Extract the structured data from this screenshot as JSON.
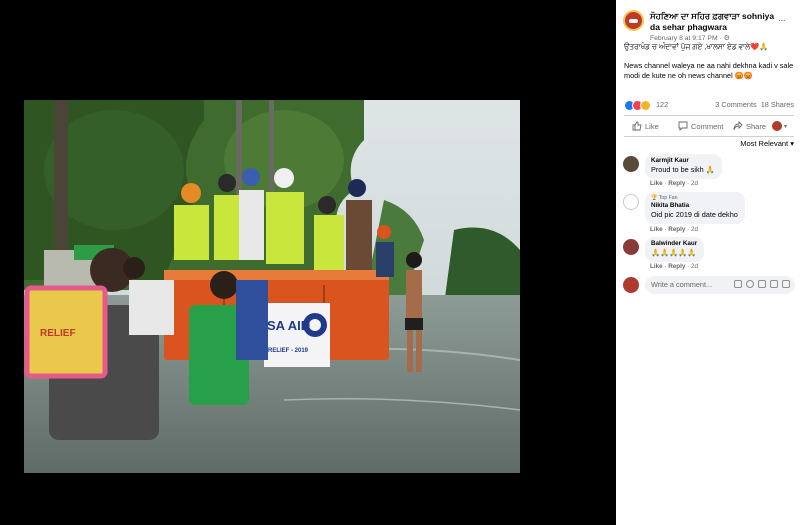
{
  "post": {
    "page_name": "ਸੋਹਣਿਆ ਦਾ ਸਹਿਰ ਫ਼ਗਵਾੜਾ sohniya da sehar phagwara",
    "meta": "February 8 at 9:17 PM · ⚙",
    "more": "···",
    "text_line1": "ਉਤਰਾਖੰਡ ਚ ਅੰਦਾਵਾਂ ਪੁੱਜ ਗਏ ,ਖਾਲਸਾ ਏਡ ਵਾਲੇ❤️🙏",
    "text_line2": "News channel waleya ne aa nahi dekhna kadi v sale modi de kute ne oh news channel 😡😡"
  },
  "photo": {
    "banner_text": "SA AID",
    "banner_sub": "RELIEF - 2019",
    "bag_text": "RELIEF"
  },
  "reactions": {
    "count": "122",
    "comments": "3 Comments",
    "shares": "18 Shares",
    "colors": [
      "#1877f2",
      "#f33e58",
      "#f7b125"
    ]
  },
  "actions": {
    "like": "Like",
    "comment": "Comment",
    "share": "Share"
  },
  "sort": {
    "label": "Most Relevant ▾"
  },
  "comments": [
    {
      "name": "Karmjit Kaur",
      "badge": "",
      "text": "Proud to be sikh 🙏",
      "like": "Like",
      "reply": "Reply",
      "time": "2d"
    },
    {
      "name": "Nikita Bhatia",
      "badge": "🏆 Top Fan",
      "text": "Oid pic 2019 di date dekho",
      "like": "Like",
      "reply": "Reply",
      "time": "2d"
    },
    {
      "name": "Balwinder Kaur",
      "badge": "",
      "text": "🙏🙏🙏🙏🙏",
      "like": "Like",
      "reply": "Reply",
      "time": "2d"
    }
  ],
  "write_comment": {
    "placeholder": "Write a comment..."
  },
  "colors": {
    "panel_bg": "#ffffff",
    "viewer_bg": "#000000",
    "muted_text": "#65676b",
    "bubble_bg": "#f0f2f5",
    "truck_orange": "#d9541e",
    "vest_yellow": "#c8e63c",
    "water": "#7d8a86"
  }
}
